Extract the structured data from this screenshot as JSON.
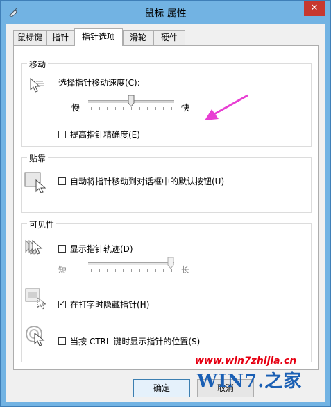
{
  "window": {
    "title": "鼠标 属性",
    "close_glyph": "✕"
  },
  "tabs": [
    {
      "label": "鼠标键"
    },
    {
      "label": "指针"
    },
    {
      "label": "指针选项"
    },
    {
      "label": "滑轮"
    },
    {
      "label": "硬件"
    }
  ],
  "motion": {
    "title": "移动",
    "speed_label": "选择指针移动速度(C):",
    "slow_label": "慢",
    "fast_label": "快",
    "speed_level": 0.5,
    "precision_label": "提高指针精确度(E)",
    "precision_checked": false
  },
  "snap": {
    "title": "贴靠",
    "snap_label": "自动将指针移动到对话框中的默认按钮(U)",
    "snap_checked": false
  },
  "visibility": {
    "title": "可见性",
    "trails_label": "显示指针轨迹(D)",
    "trails_checked": false,
    "short_label": "短",
    "long_label": "长",
    "trail_length_level": 1.0,
    "hide_typing_label": "在打字时隐藏指针(H)",
    "hide_typing_checked": true,
    "ctrl_label": "当按 CTRL 键时显示指针的位置(S)",
    "ctrl_checked": false
  },
  "buttons": {
    "ok": "确定",
    "cancel": "取消"
  },
  "watermark": {
    "site": "www.win7zhijia.cn",
    "logo": "WIN7.之家"
  },
  "colors": {
    "arrow": "#e83fd3",
    "title_bar": "#72b3e3",
    "close_button": "#c7382f"
  }
}
